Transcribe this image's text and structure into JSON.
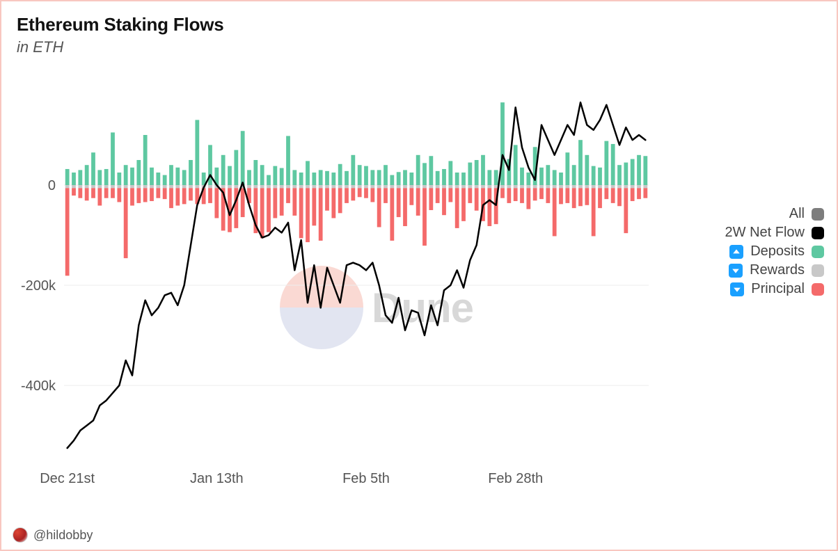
{
  "title": "Ethereum Staking Flows",
  "subtitle": "in ETH",
  "author": "@hildobby",
  "watermark": "Dune",
  "legend": {
    "all": "All",
    "netflow": "2W Net Flow",
    "deposits": "Deposits",
    "rewards": "Rewards",
    "principal": "Principal"
  },
  "colors": {
    "deposits": "#5ec8a1",
    "rewards": "#c8c8c8",
    "principal": "#f46a6a",
    "netflow": "#000000",
    "all": "#7d7d7d"
  },
  "chart_data": {
    "type": "bar",
    "ylim": [
      -550000,
      200000
    ],
    "y_ticks": [
      0,
      -200000,
      -400000
    ],
    "y_tick_labels": [
      "0",
      "-200k",
      "-400k"
    ],
    "x_tick_labels": [
      "Dec 21st",
      "Jan 13th",
      "Feb 5th",
      "Feb 28th"
    ],
    "x_tick_indices": [
      0,
      23,
      46,
      69
    ],
    "categories_count": 90,
    "series": [
      {
        "name": "Deposits",
        "values": [
          32000,
          25000,
          30000,
          40000,
          65000,
          30000,
          32000,
          105000,
          25000,
          40000,
          35000,
          50000,
          100000,
          35000,
          25000,
          20000,
          40000,
          35000,
          30000,
          50000,
          130000,
          25000,
          80000,
          35000,
          60000,
          38000,
          70000,
          108000,
          30000,
          50000,
          40000,
          20000,
          38000,
          34000,
          98000,
          30000,
          25000,
          48000,
          25000,
          30000,
          28000,
          25000,
          42000,
          28000,
          60000,
          40000,
          38000,
          30000,
          30000,
          40000,
          20000,
          26000,
          30000,
          25000,
          60000,
          44000,
          58000,
          28000,
          32000,
          48000,
          25000,
          25000,
          45000,
          50000,
          60000,
          30000,
          30000,
          165000,
          52000,
          80000,
          35000,
          25000,
          76000,
          35000,
          40000,
          30000,
          25000,
          65000,
          40000,
          90000,
          60000,
          38000,
          35000,
          88000,
          82000,
          40000,
          45000,
          52000,
          60000,
          58000
        ]
      },
      {
        "name": "Rewards",
        "values": [
          -6000,
          -6000,
          -6000,
          -6000,
          -6000,
          -6000,
          -6000,
          -6000,
          -6000,
          -6000,
          -6000,
          -6000,
          -6000,
          -6000,
          -6000,
          -6000,
          -6000,
          -6000,
          -6000,
          -6000,
          -6000,
          -6000,
          -6000,
          -6000,
          -6000,
          -6000,
          -6000,
          -6000,
          -6000,
          -6000,
          -6000,
          -6000,
          -6000,
          -6000,
          -6000,
          -6000,
          -6000,
          -6000,
          -6000,
          -6000,
          -6000,
          -6000,
          -6000,
          -6000,
          -6000,
          -6000,
          -6000,
          -6000,
          -6000,
          -6000,
          -6000,
          -6000,
          -6000,
          -6000,
          -6000,
          -6000,
          -6000,
          -6000,
          -6000,
          -6000,
          -6000,
          -6000,
          -6000,
          -6000,
          -6000,
          -6000,
          -6000,
          -6000,
          -6000,
          -6000,
          -6000,
          -6000,
          -6000,
          -6000,
          -6000,
          -6000,
          -6000,
          -6000,
          -6000,
          -6000,
          -6000,
          -6000,
          -6000,
          -6000,
          -6000,
          -6000,
          -6000,
          -6000,
          -6000,
          -6000
        ]
      },
      {
        "name": "Principal",
        "values": [
          -175000,
          -15000,
          -20000,
          -25000,
          -20000,
          -35000,
          -20000,
          -20000,
          -28000,
          -140000,
          -35000,
          -30000,
          -28000,
          -26000,
          -20000,
          -22000,
          -40000,
          -35000,
          -32000,
          -25000,
          -32000,
          -32000,
          -30000,
          -60000,
          -85000,
          -88000,
          -80000,
          -58000,
          -30000,
          -90000,
          -100000,
          -88000,
          -60000,
          -55000,
          -30000,
          -55000,
          -100000,
          -108000,
          -75000,
          -105000,
          -45000,
          -60000,
          -50000,
          -30000,
          -25000,
          -18000,
          -20000,
          -28000,
          -78000,
          -30000,
          -105000,
          -58000,
          -76000,
          -34000,
          -55000,
          -115000,
          -44000,
          -30000,
          -54000,
          -28000,
          -80000,
          -66000,
          -30000,
          -45000,
          -66000,
          -76000,
          -72000,
          -20000,
          -30000,
          -26000,
          -30000,
          -42000,
          -25000,
          -22000,
          -30000,
          -96000,
          -32000,
          -30000,
          -40000,
          -36000,
          -34000,
          -96000,
          -40000,
          -22000,
          -30000,
          -36000,
          -90000,
          -26000,
          -22000,
          -20000
        ]
      },
      {
        "name": "2W Net Flow",
        "values": [
          -525000,
          -510000,
          -490000,
          -480000,
          -470000,
          -440000,
          -430000,
          -415000,
          -400000,
          -350000,
          -380000,
          -280000,
          -230000,
          -260000,
          -245000,
          -220000,
          -215000,
          -240000,
          -200000,
          -120000,
          -40000,
          -5000,
          20000,
          0,
          -15000,
          -60000,
          -30000,
          5000,
          -40000,
          -80000,
          -105000,
          -100000,
          -85000,
          -95000,
          -75000,
          -170000,
          -110000,
          -235000,
          -160000,
          -245000,
          -165000,
          -200000,
          -235000,
          -160000,
          -155000,
          -160000,
          -170000,
          -155000,
          -200000,
          -260000,
          -275000,
          -225000,
          -290000,
          -250000,
          -255000,
          -300000,
          -240000,
          -280000,
          -210000,
          -200000,
          -170000,
          -205000,
          -150000,
          -120000,
          -40000,
          -30000,
          -40000,
          60000,
          30000,
          155000,
          75000,
          35000,
          10000,
          120000,
          90000,
          60000,
          90000,
          120000,
          100000,
          165000,
          120000,
          110000,
          130000,
          160000,
          120000,
          80000,
          115000,
          90000,
          100000,
          90000
        ]
      }
    ]
  }
}
